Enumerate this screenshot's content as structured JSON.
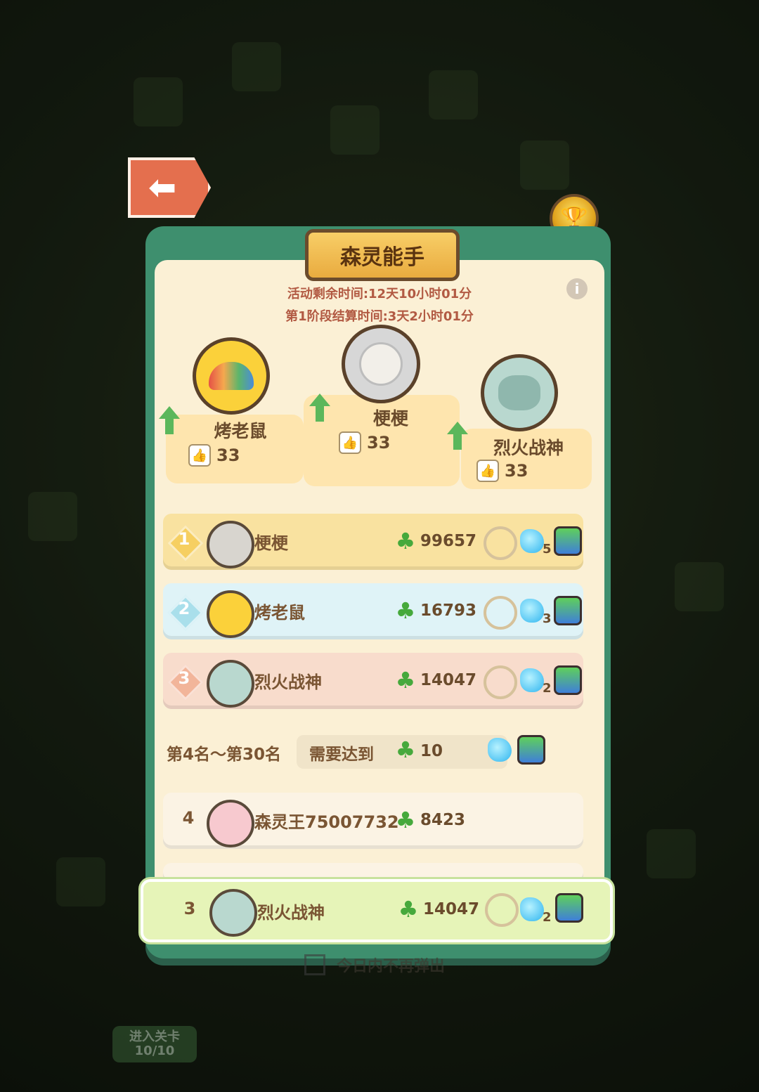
{
  "title": "森灵能手",
  "timers": {
    "activity_remaining": "活动剩余时间:12天10小时01分",
    "stage_settlement": "第1阶段结算时间:3天2小时01分"
  },
  "podium": [
    {
      "name": "烤老鼠",
      "likes": "33"
    },
    {
      "name": "梗梗",
      "likes": "33"
    },
    {
      "name": "烈火战神",
      "likes": "33"
    }
  ],
  "top_ranks": [
    {
      "rank": "1",
      "name": "梗梗",
      "score": "99657",
      "gem_count": "5"
    },
    {
      "rank": "2",
      "name": "烤老鼠",
      "score": "16793",
      "gem_count": "3"
    },
    {
      "rank": "3",
      "name": "烈火战神",
      "score": "14047",
      "gem_count": "2"
    }
  ],
  "range_requirement": {
    "range_label": "第4名～第30名",
    "need_label": "需要达到",
    "value": "10"
  },
  "other_ranks": [
    {
      "rank": "4",
      "name": "森灵王75007732",
      "score": "8423"
    }
  ],
  "my_rank": {
    "rank": "3",
    "name": "烈火战神",
    "score": "14047",
    "gem_count": "2"
  },
  "footer": {
    "checkbox_label": "今日内不再弹出"
  },
  "enter_level": {
    "label": "进入关卡",
    "progress": "10/10"
  },
  "colors": {
    "panel_green": "#3e8f6e",
    "panel_cream": "#fbf0d5",
    "row_gold": "#f9e2a0",
    "row_blue": "#dff3f7",
    "row_peach": "#f8dccc",
    "row_highlight": "#e6f4b8",
    "accent_text": "#b25a43"
  }
}
